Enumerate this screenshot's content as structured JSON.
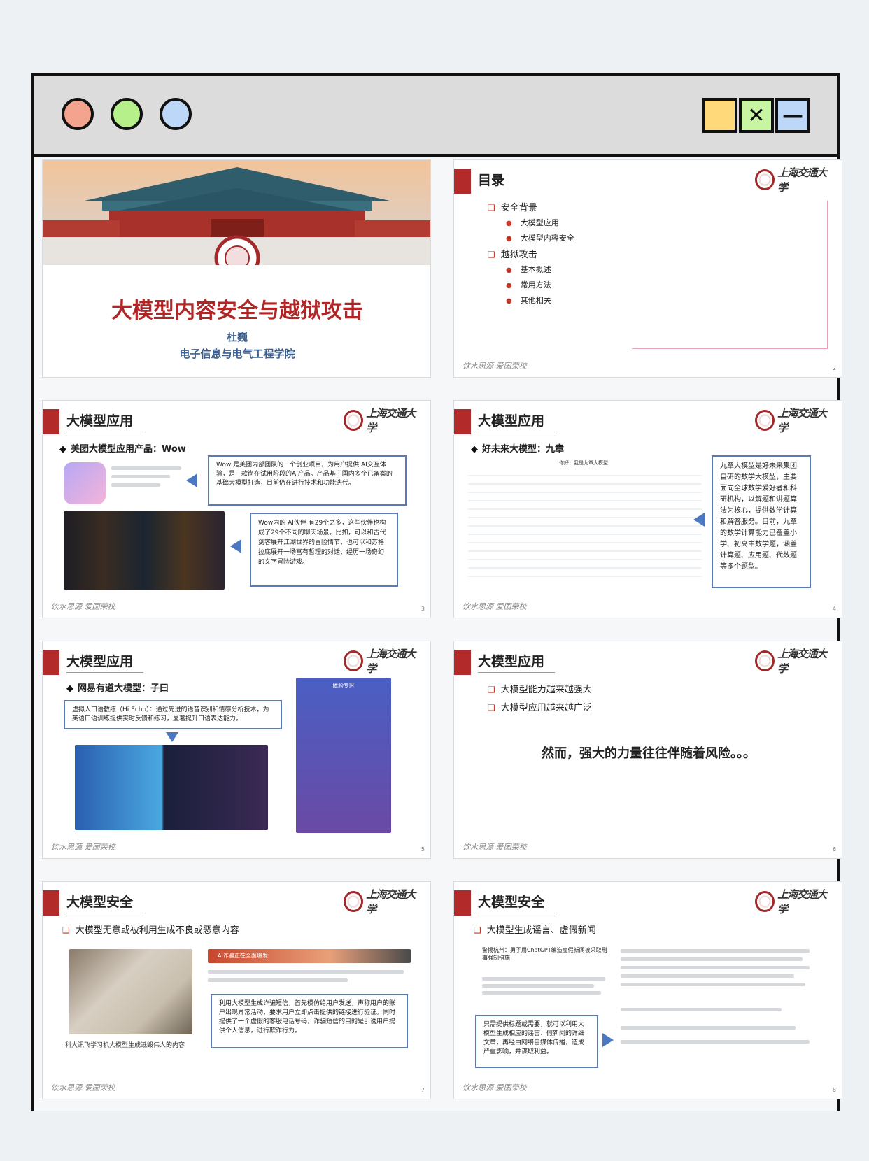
{
  "window": {
    "minimize_glyph": "—",
    "close_glyph": "✕"
  },
  "common": {
    "logo_text": "上海交通大学",
    "motto": "饮水思源 爱国荣校"
  },
  "slides": [
    {
      "title": "大模型内容安全与越狱攻击",
      "author": "杜巍",
      "school": "电子信息与电气工程学院"
    },
    {
      "title": "目录",
      "page": "2",
      "toc": [
        {
          "label": "安全背景",
          "items": [
            "大模型应用",
            "大模型内容安全"
          ]
        },
        {
          "label": "越狱攻击",
          "items": [
            "基本概述",
            "常用方法",
            "其他相关"
          ]
        }
      ]
    },
    {
      "title": "大模型应用",
      "page": "3",
      "bullet": "美团大模型应用产品：Wow",
      "box1": "Wow 是美团内部团队的一个创业项目，为用户提供 AI交互体验，是一款尚在试用阶段的AI产品。产品基于国内多个已备案的基础大模型打造，目前仍在进行技术和功能迭代。",
      "box2": "Wow内的 AI伙伴 有29个之多，这些伙伴也构成了29个不同的聊天场景。比如，可以和古代剑客展开江湖世界的冒险情节，也可以和苏格拉底展开一场富有哲理的对话，经历一场奇幻的文字冒险游戏。"
    },
    {
      "title": "大模型应用",
      "page": "4",
      "bullet": "好未来大模型：九章",
      "mock_heading": "你好，我是九章大模型",
      "box": "九章大模型是好未来集团自研的数学大模型，主要面向全球数学爱好者和科研机构，以解题和讲题算法为核心，提供数学计算和解答服务。目前，九章的数学计算能力已覆盖小学、初高中数学题，涵盖计算题、应用题、代数题等多个题型。"
    },
    {
      "title": "大模型应用",
      "page": "5",
      "bullet": "网易有道大模型：子曰",
      "box": "虚拟人口语教练（Hi Echo）：通过先进的语音识别和情感分析技术，为英语口语训练提供实时反馈和练习，显著提升口语表达能力。",
      "panel_title": "体验专区"
    },
    {
      "title": "大模型应用",
      "page": "6",
      "items": [
        "大模型能力越来越强大",
        "大模型应用越来越广泛"
      ],
      "statement": "然而，强大的力量往往伴随着风险。。。"
    },
    {
      "title": "大模型安全",
      "page": "7",
      "bullet": "大模型无意或被利用生成不良或恶意内容",
      "caption": "科大讯飞学习机大模型生成诋毁伟人的内容",
      "news_tag": "AI诈骗正在全面爆发",
      "box": "利用大模型生成诈骗短信，首先模仿给用户发送，声称用户的账户出现异常活动，要求用户立即点击提供的链接进行验证。同时提供了一个虚假的客服电话号码，诈骗短信的目的是引诱用户提供个人信息，进行欺诈行为。"
    },
    {
      "title": "大模型安全",
      "page": "8",
      "bullet": "大模型生成谣言、虚假新闻",
      "news_headline": "警惕杭州：男子用ChatGPT编造虚假新闻被采取刑事强制措施",
      "box": "只需提供标题或需要，就可以利用大模型生成相应的谣言、假新闻的详细文章，再经由网络自媒体传播，造成严重影响，并谋取利益。"
    }
  ]
}
